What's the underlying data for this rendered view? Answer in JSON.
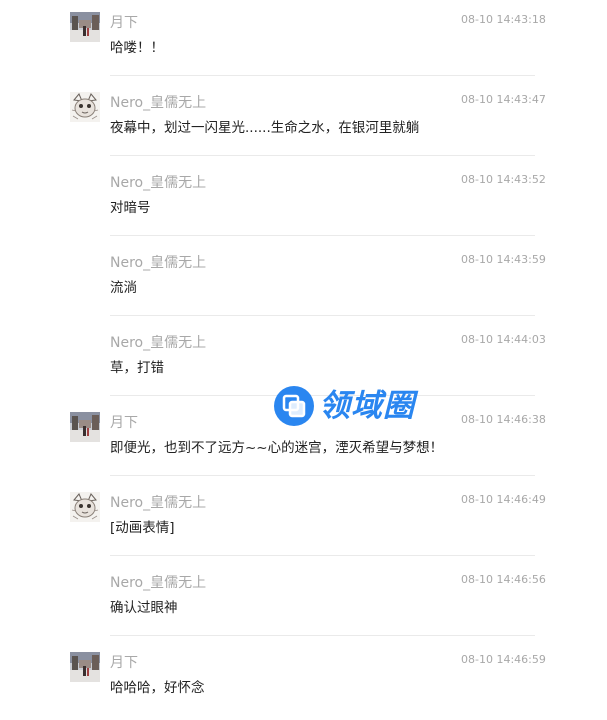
{
  "messages": [
    {
      "name": "月下",
      "time": "08-10 14:43:18",
      "text": "哈喽！！",
      "avatar": "winter-street-avatar"
    },
    {
      "name": "Nero_皇儒无上",
      "time": "08-10 14:43:47",
      "text": "夜幕中，划过一闪星光......生命之水，在银河里就躺",
      "avatar": "sketch-creature-avatar"
    },
    {
      "name": "Nero_皇儒无上",
      "time": "08-10 14:43:52",
      "text": "对暗号",
      "avatar": ""
    },
    {
      "name": "Nero_皇儒无上",
      "time": "08-10 14:43:59",
      "text": "流淌",
      "avatar": ""
    },
    {
      "name": "Nero_皇儒无上",
      "time": "08-10 14:44:03",
      "text": "草，打错",
      "avatar": ""
    },
    {
      "name": "月下",
      "time": "08-10 14:46:38",
      "text": "即便光，也到不了远方~~心的迷宫，湮灭希望与梦想！",
      "avatar": "winter-street-avatar"
    },
    {
      "name": "Nero_皇儒无上",
      "time": "08-10 14:46:49",
      "text": "[动画表情]",
      "avatar": "sketch-creature-avatar"
    },
    {
      "name": "Nero_皇儒无上",
      "time": "08-10 14:46:56",
      "text": "确认过眼神",
      "avatar": ""
    },
    {
      "name": "月下",
      "time": "08-10 14:46:59",
      "text": "哈哈哈，好怀念",
      "avatar": "winter-street-avatar"
    }
  ],
  "watermark": {
    "text": "领域圈",
    "color": "#2a86f0"
  }
}
